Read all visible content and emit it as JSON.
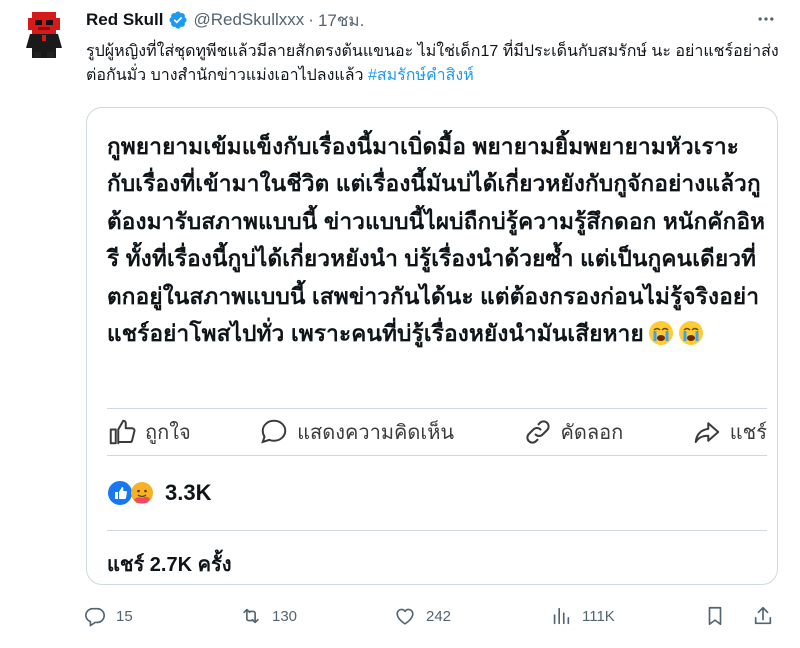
{
  "tweet": {
    "author_name": "Red Skull",
    "handle": "@RedSkullxxx",
    "separator": "·",
    "time": "17ชม.",
    "text": "รูปผู้หญิงที่ใส่ชุดทูพีชแล้วมีลายสักตรงต้นแขนอะ ไม่ใช่เด็ก17 ที่มีประเด็นกับสมรักษ์ นะ อย่าแชร์อย่าส่งต่อกันมั่ว บางสำนักข่าวแม่งเอาไปลงแล้ว ",
    "hashtag": "#สมรักษ์คำสิงห์",
    "more_icon": "more-icon",
    "verified_color": "#1d9bf0"
  },
  "fb_post": {
    "text": "กูพยายามเข้มแข็งกับเรื่องนี้มาเบิ่ดมื้อ พยายามยิ้มพยายามหัวเราะกับเรื่องที่เข้ามาในชีวิต แต่เรื่องนี้มันบ่ได้เกี่ยวหยังกับกูจักอย่างแล้วกูต้องมารับสภาพแบบนี้ ข่าวแบบนี้ไผบ่ถืกบ่รู้ความรู้สึกดอก หนักคักอิหรี ทั้งที่เรื่องนี้กูบ่ได้เกี่ยวหยังนำ บ่รู้เรื่องนำด้วยซ้ำ แต่เป็นกูคนเดียวที่ตกอยู่ในสภาพแบบนี้ เสพข่าวกันได้นะ แต่ต้องกรองก่อนไม่รู้จริงอย่าแชร์อย่าโพสไปทั่ว เพราะคนที่บ่รู้เรื่องหยังนำมันเสียหาย",
    "actions": {
      "like": "ถูกใจ",
      "comment": "แสดงความคิดเห็น",
      "copy": "คัดลอก",
      "share": "แชร์"
    },
    "reactions_count": "3.3K",
    "shares_label": "แชร์ 2.7K ครั้ง"
  },
  "tweet_actions": {
    "replies": "15",
    "retweets": "130",
    "likes": "242",
    "views": "111K"
  }
}
